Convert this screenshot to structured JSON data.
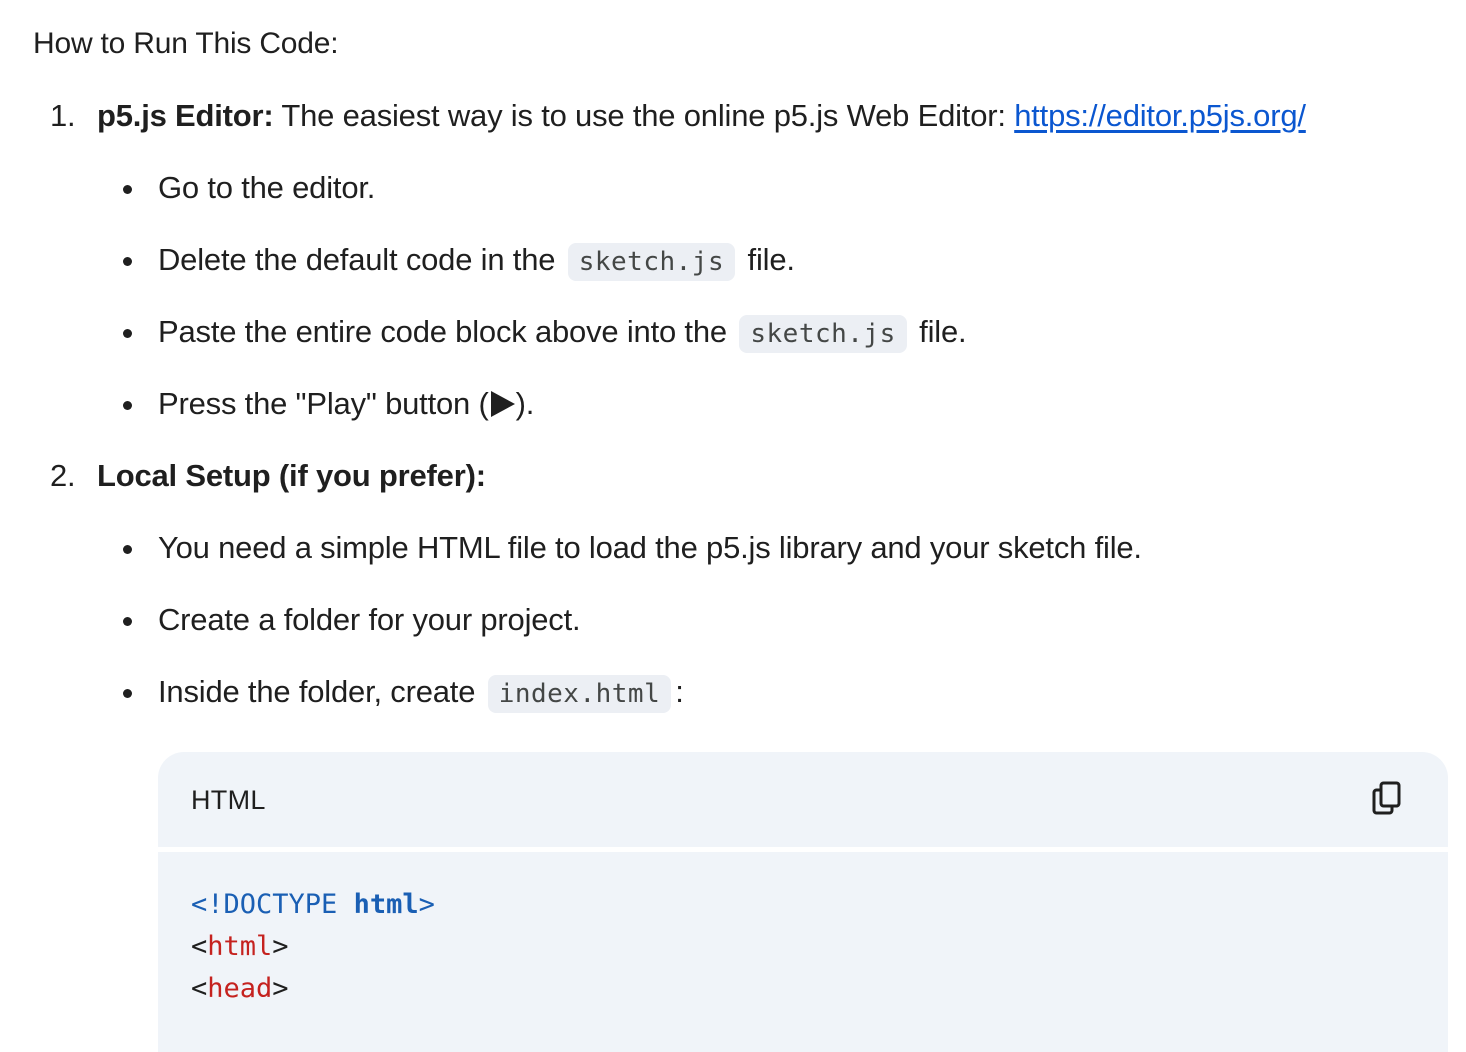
{
  "section": {
    "heading": "How to Run This Code:"
  },
  "steps": [
    {
      "number": "1.",
      "title": "p5.js Editor:",
      "text": " The easiest way is to use the online p5.js Web Editor: ",
      "link": "https://editor.p5js.org/",
      "bullets": [
        {
          "text": "Go to the editor."
        },
        {
          "before": "Delete the default code in the",
          "code": "sketch.js",
          "after": "file."
        },
        {
          "before": "Paste the entire code block above into the",
          "code": "sketch.js",
          "after": "file."
        },
        {
          "before": "Press the \"Play\" button (",
          "after": ")."
        }
      ]
    },
    {
      "number": "2.",
      "title": "Local Setup (if you prefer):",
      "bullets": [
        {
          "text": "You need a simple HTML file to load the p5.js library and your sketch file."
        },
        {
          "text": "Create a folder for your project."
        },
        {
          "before": "Inside the folder, create",
          "code": "index.html",
          "after": ":"
        }
      ]
    }
  ],
  "code_block": {
    "language": "HTML",
    "copy_icon": "copy-icon",
    "lines": [
      {
        "open": "<!",
        "keyword": "DOCTYPE",
        "space": " ",
        "name": "html",
        "close": ">"
      },
      {
        "open": "<",
        "tag": "html",
        "close": ">"
      },
      {
        "open": "<",
        "tag": "head",
        "close": ">"
      }
    ]
  },
  "colors": {
    "link": "#0b57d0",
    "code_background": "#f0f4f9",
    "inline_code_background": "#eceff4",
    "code_keyword": "#1a5fb4",
    "code_tag": "#c5221f"
  }
}
